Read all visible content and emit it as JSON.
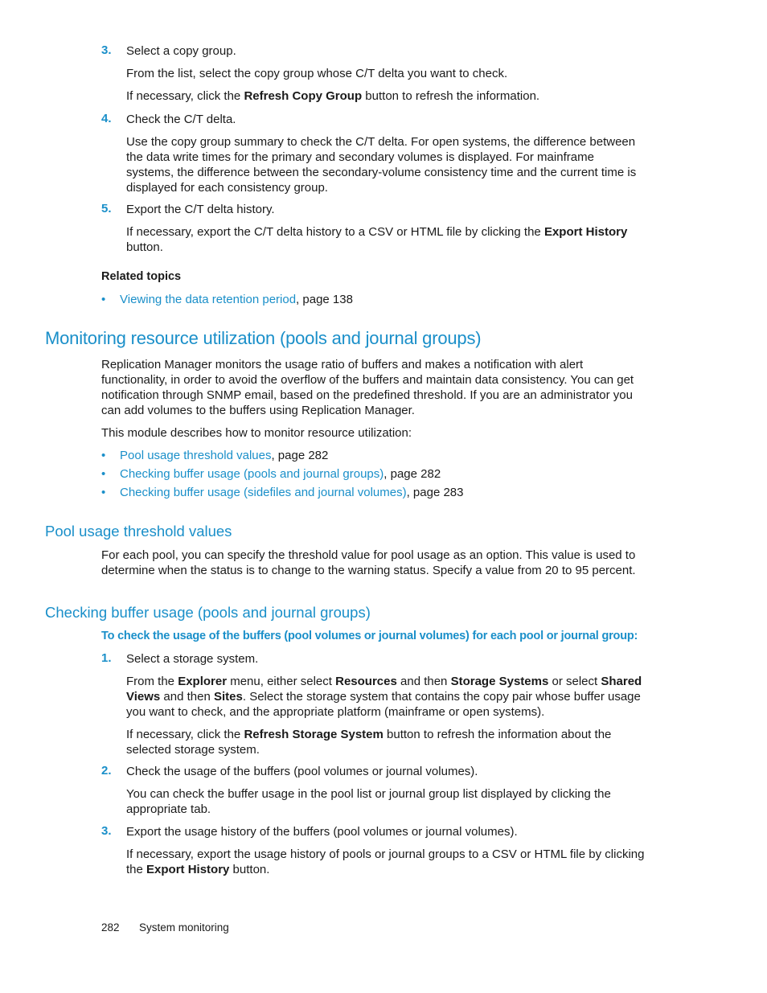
{
  "section_top": {
    "steps": [
      {
        "number": "3.",
        "title": "Select a copy group.",
        "paragraphs": [
          {
            "text": "From the list, select the copy group whose C/T delta you want to check."
          },
          {
            "pre": "If necessary, click the ",
            "bold": "Refresh Copy Group",
            "post": " button to refresh the information."
          }
        ]
      },
      {
        "number": "4.",
        "title": "Check the C/T delta.",
        "paragraphs": [
          {
            "text": "Use the copy group summary to check the C/T delta. For open systems, the difference between the data write times for the primary and secondary volumes is displayed. For mainframe systems, the difference between the secondary-volume consistency time and the current time is displayed for each consistency group."
          }
        ]
      },
      {
        "number": "5.",
        "title": "Export the C/T delta history.",
        "paragraphs": [
          {
            "pre": "If necessary, export the C/T delta history to a CSV or HTML file by clicking the ",
            "bold": "Export History",
            "post": " button."
          }
        ]
      }
    ],
    "related_topics": {
      "heading": "Related topics",
      "items": [
        {
          "link": "Viewing the data retention period",
          "suffix": ", page 138"
        }
      ]
    }
  },
  "section_monitoring": {
    "heading": "Monitoring resource utilization (pools and journal groups)",
    "intro": "Replication Manager monitors the usage ratio of buffers and makes a notification with alert functionality, in order to avoid the overflow of the buffers and maintain data consistency. You can get notification through SNMP email, based on the predefined threshold. If you are an administrator you can add volumes to the buffers using Replication Manager.",
    "module_text": "This module describes how to monitor resource utilization:",
    "links": [
      {
        "link": "Pool usage threshold values",
        "suffix": ", page 282"
      },
      {
        "link": "Checking buffer usage (pools and journal groups)",
        "suffix": ", page 282"
      },
      {
        "link": "Checking buffer usage (sidefiles and journal volumes)",
        "suffix": ", page 283"
      }
    ]
  },
  "section_threshold": {
    "heading": "Pool usage threshold values",
    "body": "For each pool, you can specify the threshold value for pool usage as an option. This value is used to determine when the status is to change to the warning status. Specify a value from 20 to 95 percent."
  },
  "section_checking": {
    "heading": "Checking buffer usage (pools and journal groups)",
    "procedure_title": "To check the usage of the buffers (pool volumes or journal volumes) for each pool or journal group:",
    "steps": [
      {
        "number": "1.",
        "title": "Select a storage system.",
        "p1": {
          "t1": "From the ",
          "b1": "Explorer",
          "t2": " menu, either select ",
          "b2": "Resources",
          "t3": " and then ",
          "b3": "Storage Systems",
          "t4": " or select ",
          "b4": "Shared Views",
          "t5": " and then ",
          "b5": "Sites",
          "t6": ". Select the storage system that contains the copy pair whose buffer usage you want to check, and the appropriate platform (mainframe or open systems)."
        },
        "p2": {
          "pre": "If necessary, click the ",
          "bold": "Refresh Storage System",
          "post": " button to refresh the information about the selected storage system."
        }
      },
      {
        "number": "2.",
        "title": "Check the usage of the buffers (pool volumes or journal volumes).",
        "p1": {
          "text": "You can check the buffer usage in the pool list or journal group list displayed by clicking the appropriate tab."
        }
      },
      {
        "number": "3.",
        "title": "Export the usage history of the buffers (pool volumes or journal volumes).",
        "p1": {
          "pre": "If necessary, export the usage history of pools or journal groups to a CSV or HTML file by clicking the ",
          "bold": "Export History",
          "post": " button."
        }
      }
    ]
  },
  "footer": {
    "page_number": "282",
    "chapter": "System monitoring"
  },
  "colors": {
    "accent": "#1a8fc9",
    "text": "#1a1a1a"
  }
}
